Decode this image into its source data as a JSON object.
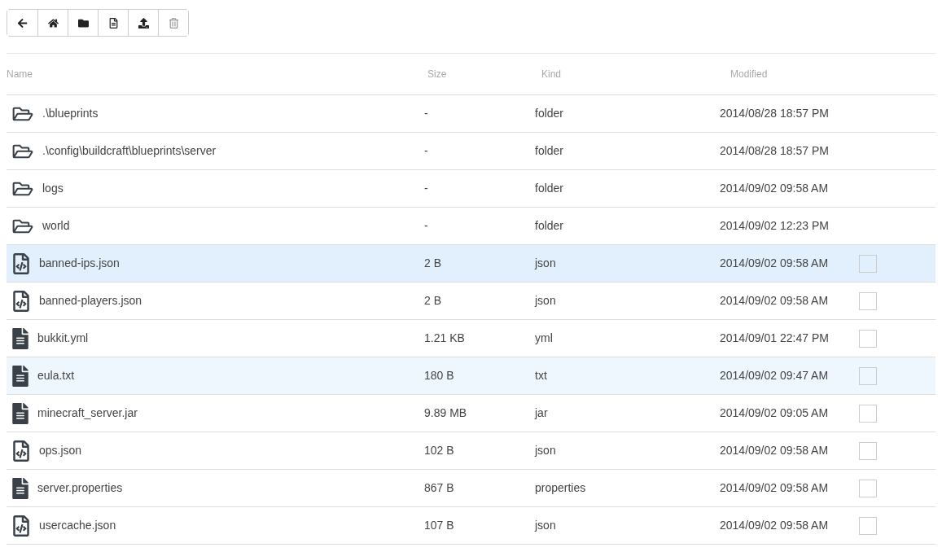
{
  "toolbar": [
    {
      "kind": "back",
      "disabled": false
    },
    {
      "kind": "home",
      "disabled": false
    },
    {
      "kind": "new-folder",
      "disabled": false
    },
    {
      "kind": "new-file",
      "disabled": false
    },
    {
      "kind": "upload",
      "disabled": false
    },
    {
      "kind": "delete",
      "disabled": true
    }
  ],
  "table": {
    "columns": [
      "Name",
      "Size",
      "Kind",
      "Modified"
    ],
    "rows": [
      {
        "kind": "folder",
        "name": ".\\blueprints",
        "size": "-",
        "type": "folder",
        "modified": "2014/08/28 18:57 PM",
        "selected": false,
        "hovered": false
      },
      {
        "kind": "folder",
        "name": ".\\config\\buildcraft\\blueprints\\server",
        "size": "-",
        "type": "folder",
        "modified": "2014/08/28 18:57 PM",
        "selected": false,
        "hovered": false
      },
      {
        "kind": "folder",
        "name": "logs",
        "size": "-",
        "type": "folder",
        "modified": "2014/09/02 09:58 AM",
        "selected": false,
        "hovered": false
      },
      {
        "kind": "folder",
        "name": "world",
        "size": "-",
        "type": "folder",
        "modified": "2014/09/02 12:23 PM",
        "selected": false,
        "hovered": false
      },
      {
        "kind": "code",
        "name": "banned-ips.json",
        "size": "2 B",
        "type": "json",
        "modified": "2014/09/02 09:58 AM",
        "selected": true,
        "hovered": false,
        "checked": false
      },
      {
        "kind": "code",
        "name": "banned-players.json",
        "size": "2 B",
        "type": "json",
        "modified": "2014/09/02 09:58 AM",
        "selected": false,
        "hovered": false,
        "checked": false
      },
      {
        "kind": "text",
        "name": "bukkit.yml",
        "size": "1.21 KB",
        "type": "yml",
        "modified": "2014/09/01 22:47 PM",
        "selected": false,
        "hovered": false,
        "checked": false
      },
      {
        "kind": "text",
        "name": "eula.txt",
        "size": "180 B",
        "type": "txt",
        "modified": "2014/09/02 09:47 AM",
        "selected": false,
        "hovered": true,
        "checked": false
      },
      {
        "kind": "text",
        "name": "minecraft_server.jar",
        "size": "9.89 MB",
        "type": "jar",
        "modified": "2014/09/02 09:05 AM",
        "selected": false,
        "hovered": false,
        "checked": false
      },
      {
        "kind": "code",
        "name": "ops.json",
        "size": "102 B",
        "type": "json",
        "modified": "2014/09/02 09:58 AM",
        "selected": false,
        "hovered": false,
        "checked": false
      },
      {
        "kind": "text",
        "name": "server.properties",
        "size": "867 B",
        "type": "properties",
        "modified": "2014/09/02 09:58 AM",
        "selected": false,
        "hovered": false,
        "checked": false
      },
      {
        "kind": "code",
        "name": "usercache.json",
        "size": "107 B",
        "type": "json",
        "modified": "2014/09/02 09:58 AM",
        "selected": false,
        "hovered": false,
        "checked": false
      }
    ]
  }
}
